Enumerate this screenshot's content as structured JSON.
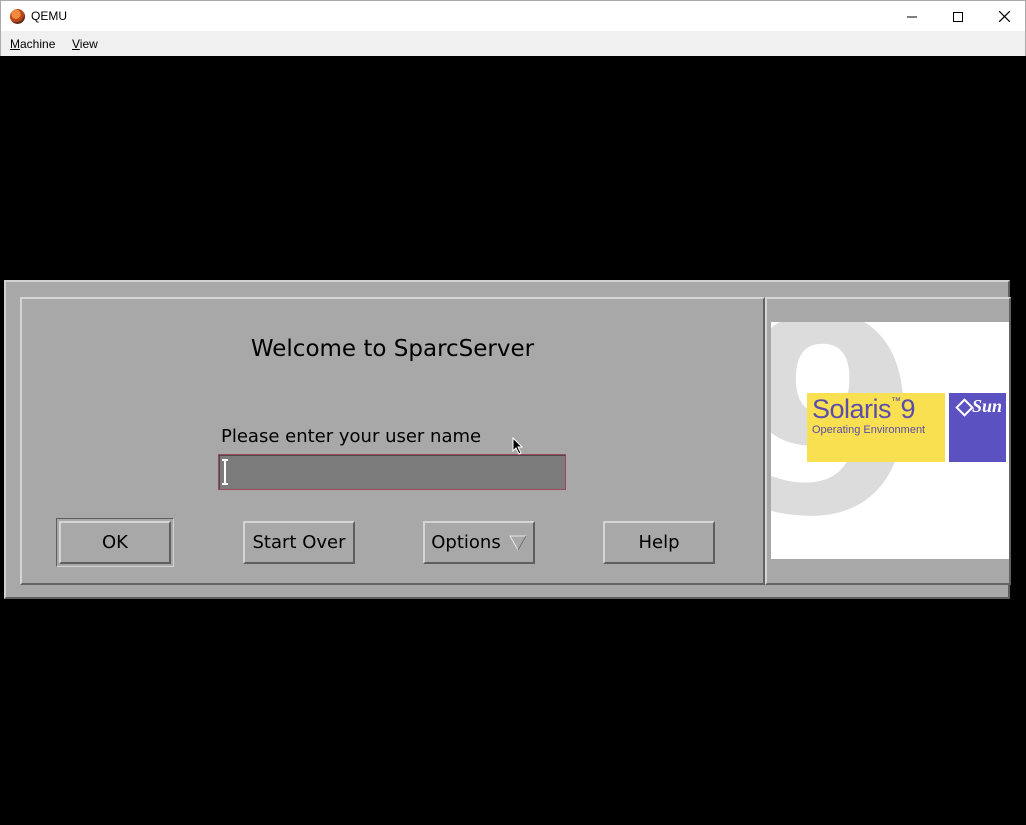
{
  "window": {
    "title": "QEMU",
    "controls": {
      "minimize_icon": "minimize-icon",
      "maximize_icon": "maximize-icon",
      "close_icon": "close-icon"
    }
  },
  "menubar": {
    "items": [
      {
        "accelerator": "M",
        "rest": "achine"
      },
      {
        "accelerator": "V",
        "rest": "iew"
      }
    ]
  },
  "login": {
    "welcome": "Welcome to SparcServer",
    "prompt": "Please enter your user name",
    "username_value": "",
    "buttons": {
      "ok": "OK",
      "start_over": "Start Over",
      "options": "Options",
      "help": "Help"
    }
  },
  "logo": {
    "product": "Solaris",
    "version": "9",
    "subtitle": "Operating Environment",
    "vendor": "Sun"
  },
  "colors": {
    "dialog_bg": "#a8a8a8",
    "field_bg": "#7b7b7b",
    "field_border": "#a04858",
    "solaris_yellow": "#f8e050",
    "solaris_purple": "#5a4dab",
    "sun_blue": "#5b51c0"
  }
}
